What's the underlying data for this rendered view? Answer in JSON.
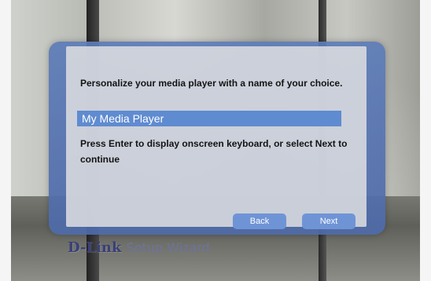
{
  "dialog": {
    "prompt": "Personalize your media player with a name of your choice.",
    "name_value": "My Media Player",
    "hint": "Press Enter to display onscreen keyboard, or select Next to continue",
    "buttons": {
      "back_label": "Back",
      "next_label": "Next"
    }
  },
  "brand": {
    "logo": "D-Link",
    "subtitle": "Setup Wizard"
  },
  "colors": {
    "dialog_frame": "#5D7CB8",
    "field_highlight": "#5F8BD0",
    "button": "#6F94D6"
  }
}
